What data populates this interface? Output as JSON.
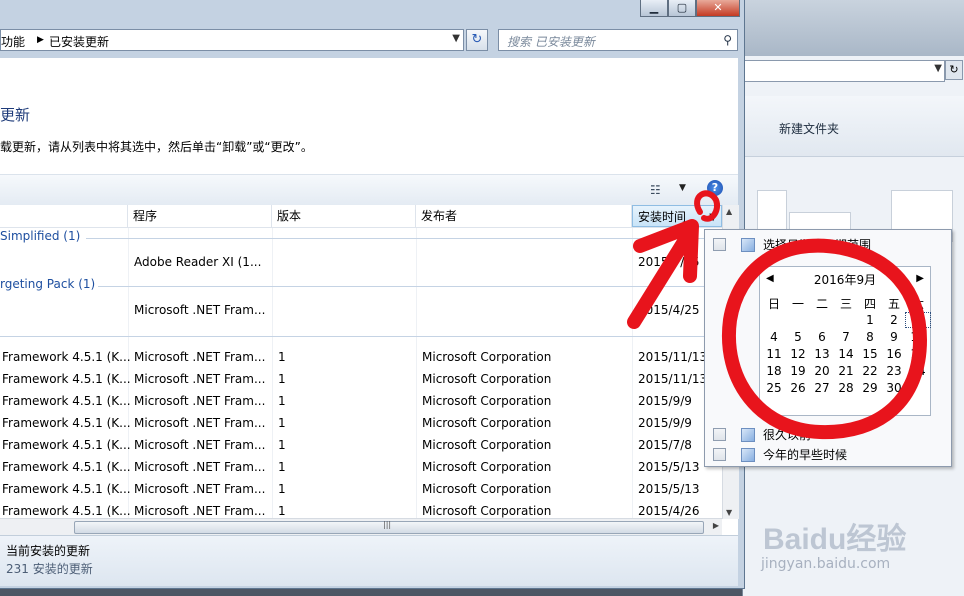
{
  "address_bar": {
    "crumbs": [
      "功能",
      "已安装更新"
    ]
  },
  "search": {
    "placeholder": "搜索 已安装更新"
  },
  "page": {
    "title": "更新",
    "description": "载更新，请从列表中将其选中，然后单击“卸载”或“更改”。"
  },
  "columns": {
    "name": "",
    "program": "程序",
    "version": "版本",
    "publisher": "发布者",
    "installed": "安装时间"
  },
  "groups": [
    {
      "label": "Simplified (1)",
      "rows": [
        {
          "name": "",
          "program": "Adobe Reader XI (1...",
          "version": "",
          "publisher": "",
          "installed": "2015/7/15"
        }
      ]
    },
    {
      "label": "rgeting Pack (1)",
      "rows": [
        {
          "name": "",
          "program": "Microsoft .NET Fram...",
          "version": "",
          "publisher": "",
          "installed": "2015/4/25"
        }
      ]
    },
    {
      "label": "",
      "rows": [
        {
          "name": "Framework 4.5.1 (K...",
          "program": "Microsoft .NET Fram...",
          "version": "1",
          "publisher": "Microsoft Corporation",
          "installed": "2015/11/13"
        },
        {
          "name": "Framework 4.5.1 (K...",
          "program": "Microsoft .NET Fram...",
          "version": "1",
          "publisher": "Microsoft Corporation",
          "installed": "2015/11/13"
        },
        {
          "name": "Framework 4.5.1 (K...",
          "program": "Microsoft .NET Fram...",
          "version": "1",
          "publisher": "Microsoft Corporation",
          "installed": "2015/9/9"
        },
        {
          "name": "Framework 4.5.1 (K...",
          "program": "Microsoft .NET Fram...",
          "version": "1",
          "publisher": "Microsoft Corporation",
          "installed": "2015/9/9"
        },
        {
          "name": "Framework 4.5.1 (K...",
          "program": "Microsoft .NET Fram...",
          "version": "1",
          "publisher": "Microsoft Corporation",
          "installed": "2015/7/8"
        },
        {
          "name": "Framework 4.5.1 (K...",
          "program": "Microsoft .NET Fram...",
          "version": "1",
          "publisher": "Microsoft Corporation",
          "installed": "2015/5/13"
        },
        {
          "name": "Framework 4.5.1 (K...",
          "program": "Microsoft .NET Fram...",
          "version": "1",
          "publisher": "Microsoft Corporation",
          "installed": "2015/5/13"
        },
        {
          "name": "Framework 4.5.1 (K...",
          "program": "Microsoft .NET Fram...",
          "version": "1",
          "publisher": "Microsoft Corporation",
          "installed": "2015/4/26"
        }
      ]
    }
  ],
  "filter_popup": {
    "options": [
      "选择日期或日期范围",
      "很久以前",
      "今年的早些时候"
    ],
    "calendar": {
      "title": "2016年9月",
      "weekdays": [
        "日",
        "一",
        "二",
        "三",
        "四",
        "五",
        "六"
      ],
      "first_weekday_index": 4,
      "days_in_month": 30,
      "today": 3
    }
  },
  "status": {
    "title": "当前安装的更新",
    "count": "231 安装的更新"
  },
  "background_window": {
    "toolbar_label": "新建文件夹",
    "watermark": "Baidu经验",
    "watermark_url": "jingyan.baidu.com"
  },
  "colors": {
    "annotation": "#e8141c",
    "link": "#1e4fa0",
    "title": "#1e3b7a"
  },
  "icons": [
    "minimize-icon",
    "maximize-icon",
    "close-icon",
    "refresh-icon",
    "search-icon",
    "view-options-icon",
    "help-icon",
    "calendar-icon"
  ]
}
